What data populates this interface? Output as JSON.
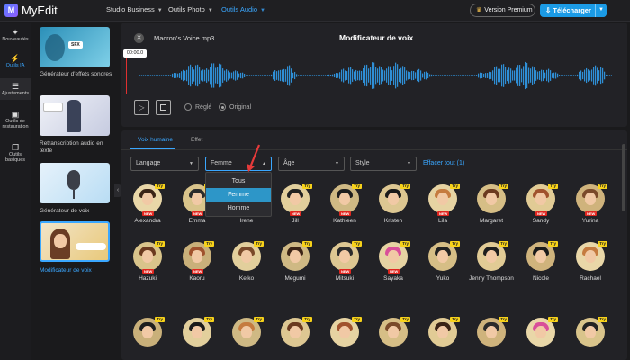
{
  "app": {
    "logo_letter": "M",
    "name": "MyEdit"
  },
  "topnav": [
    {
      "label": "Studio Business",
      "active": false
    },
    {
      "label": "Outils Photo",
      "active": false
    },
    {
      "label": "Outils Audio",
      "active": true
    }
  ],
  "header": {
    "premium_label": "Version Premium",
    "download_label": "Télécharger"
  },
  "leftnav": [
    {
      "label": "Nouveautés",
      "icon": "sparkle-icon"
    },
    {
      "label": "Outils IA",
      "icon": "magic-wand-icon",
      "active": true
    },
    {
      "label": "Ajustements",
      "icon": "sliders-icon"
    },
    {
      "label": "Outils de restauration",
      "icon": "restore-icon"
    },
    {
      "label": "Outils basiques",
      "icon": "basic-tools-icon"
    }
  ],
  "tools": [
    {
      "label": "Générateur d'effets sonores",
      "thumb_text": "SFX"
    },
    {
      "label": "Retranscription audio en texte",
      "thumb_text": ""
    },
    {
      "label": "Générateur de voix",
      "thumb_text": ""
    },
    {
      "label": "Modificateur de voix",
      "thumb_text": "",
      "active": true
    }
  ],
  "player": {
    "filename": "Macron's Voice.mp3",
    "title": "Modificateur de voix",
    "time": "00:00.0",
    "radio_regle": "Réglé",
    "radio_original": "Original"
  },
  "library": {
    "tabs": [
      {
        "label": "Voix humaine",
        "active": true
      },
      {
        "label": "Effet",
        "active": false
      }
    ],
    "filters": {
      "langage": "Langage",
      "genre": "Femme",
      "age": "Âge",
      "style": "Style"
    },
    "clear_all": "Effacer tout (1)",
    "dropdown_options": [
      {
        "label": "Tous"
      },
      {
        "label": "Femme",
        "selected": true
      },
      {
        "label": "Homme"
      }
    ],
    "try_label": "Try",
    "new_label": "NEW",
    "voices_row1": [
      "Alexandra",
      "Emma",
      "Irene",
      "Jill",
      "Kathleen",
      "Kristen",
      "Lila",
      "Margaret",
      "Sandy",
      "Yurina"
    ],
    "voices_row2": [
      "Hazuki",
      "Kaoru",
      "Keiko",
      "Megumi",
      "Mitsuki",
      "Sayaka",
      "Yuko",
      "Jenny Thompson",
      "Nicole",
      "Rachael"
    ]
  },
  "colors": {
    "accent": "#3aa7ff",
    "download": "#1b9be6",
    "try_badge": "#f7d21a",
    "new_badge": "#e0261f",
    "wave": "#2f8fd6"
  }
}
